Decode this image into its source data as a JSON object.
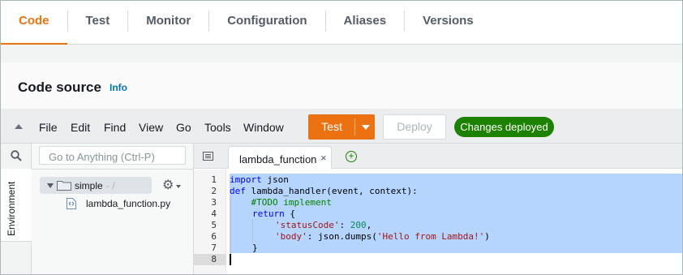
{
  "tabs": [
    "Code",
    "Test",
    "Monitor",
    "Configuration",
    "Aliases",
    "Versions"
  ],
  "active_tab": "Code",
  "section": {
    "title": "Code source",
    "info": "Info"
  },
  "menu": [
    "File",
    "Edit",
    "Find",
    "View",
    "Go",
    "Tools",
    "Window"
  ],
  "buttons": {
    "test": "Test",
    "deploy": "Deploy"
  },
  "status_badge": "Changes deployed",
  "sidebar": {
    "search_placeholder": "Go to Anything (Ctrl-P)",
    "environment_label": "Environment",
    "folder": {
      "name": "simple",
      "path": "- /"
    },
    "file": "lambda_function.py"
  },
  "editor": {
    "tab_name": "lambda_function",
    "close": "×",
    "add": "+",
    "line_numbers": [
      "1",
      "2",
      "3",
      "4",
      "5",
      "6",
      "7",
      "8"
    ],
    "code": {
      "l1_kw": "import",
      "l1_rest": " json",
      "l2_kw": "def",
      "l2_rest": " lambda_handler(event, context):",
      "l3": "    #TODO implement",
      "l4_kw": "return",
      "l4_rest": " {",
      "l5_key": "'statusCode'",
      "l5_colon": ": ",
      "l5_val": "200",
      "l5_end": ",",
      "l6_key": "'body'",
      "l6_mid": ": json.dumps(",
      "l6_str": "'Hello from Lambda!'",
      "l6_end": ")",
      "l7": "}"
    }
  },
  "colors": {
    "accent": "#ec7211",
    "success": "#1d8102",
    "link": "#0073bb",
    "selection": "#b5d5ff"
  },
  "icons": [
    "collapse-icon",
    "search-icon",
    "folder-icon",
    "gear-icon",
    "python-file-icon",
    "tabs-menu-icon",
    "close-icon",
    "add-tab-icon",
    "dropdown-caret-icon"
  ]
}
